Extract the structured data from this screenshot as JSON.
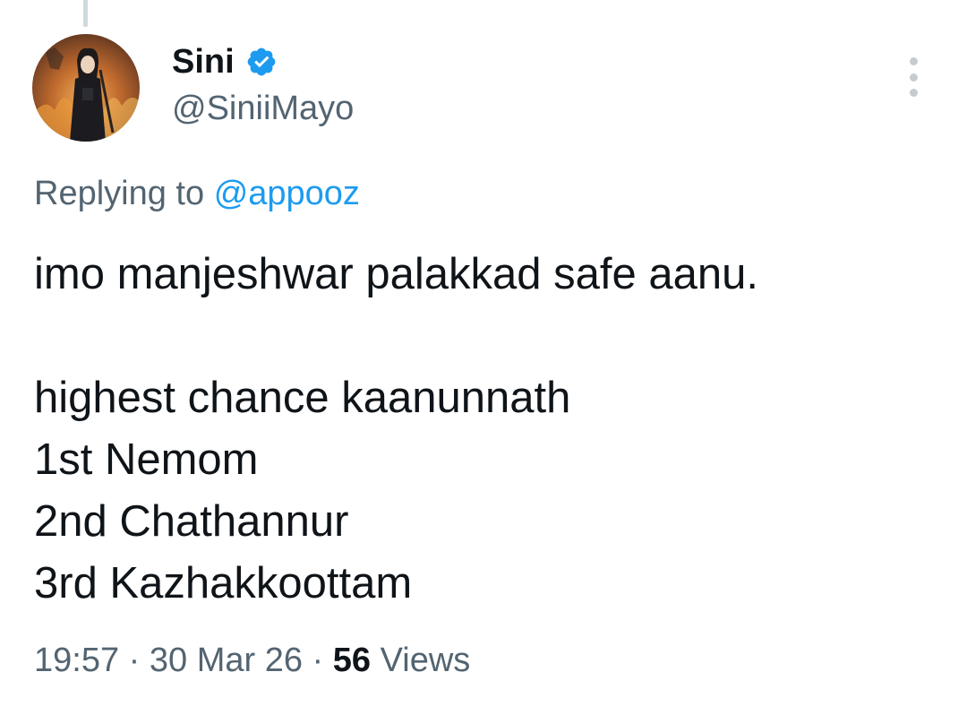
{
  "author": {
    "display_name": "Sini",
    "handle": "@SiniiMayo",
    "verified": true
  },
  "reply": {
    "prefix": "Replying to",
    "mention": "@appooz"
  },
  "tweet": {
    "lines": [
      "imo manjeshwar palakkad safe aanu.",
      "",
      "highest chance kaanunnath",
      "1st Nemom",
      "2nd Chathannur",
      "3rd Kazhakkoottam"
    ]
  },
  "meta": {
    "time": "19:57",
    "separator": "·",
    "date": "30 Mar 26",
    "views_count": "56",
    "views_label": "Views"
  },
  "colors": {
    "text": "#0f1419",
    "secondary": "#536471",
    "link": "#1d9bf0",
    "verified": "#1d9bf0"
  },
  "icons": {
    "verified": "verified-badge-icon",
    "more": "more-options-icon"
  }
}
